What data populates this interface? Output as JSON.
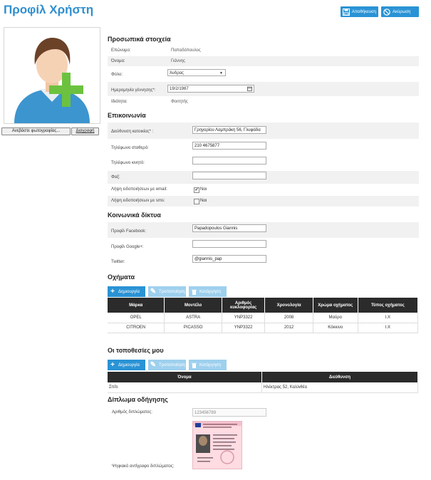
{
  "page": {
    "title": "Προφίλ Χρήστη"
  },
  "header_buttons": {
    "save": "Αποθήκευση",
    "cancel": "Ακύρωση"
  },
  "photo": {
    "file_button": "Ανεβάστε φωτογραφίας...",
    "delete_button": "Διαγραφή"
  },
  "personal": {
    "heading": "Προσωπικά στοιχεία",
    "surname_label": "Επώνυμο:",
    "surname_value": "Παπαδόπουλος",
    "name_label": "Όνομα:",
    "name_value": "Γιάννης",
    "gender_label": "Φύλο:",
    "gender_value": "Άνδρας",
    "birth_label": "Ημερομηνία γέννησης*:",
    "birth_value": "19/2/1987",
    "role_label": "Ιδιότητα:",
    "role_value": "Φοιτητής"
  },
  "contact": {
    "heading": "Επικοινωνία",
    "address_label": "Διεύθυνση κατοικίας* :",
    "address_value": "Γρηγορίου Λαμπράκη 56, Γλυφάδα",
    "phone_label": "Τηλέφωνο σταθερό:",
    "phone_value": "210 4675877",
    "mobile_label": "Τηλέφωνο κινητό:",
    "mobile_value": "",
    "fax_label": "Φαξ:",
    "fax_value": "",
    "email_notif_label": "Λήψη ειδοποιήσεων με email:",
    "email_notif_check": "✔",
    "email_notif_text": "Ναι",
    "sms_notif_label": "Λήψη ειδοποιήσεων με sms:",
    "sms_notif_text": "Ναι"
  },
  "social": {
    "heading": "Κοινωνικά δίκτυα",
    "facebook_label": "Προφίλ Facebook:",
    "facebook_value": "Papadopoulos Giannis",
    "google_label": "Προφίλ Google+:",
    "google_value": "",
    "twitter_label": "Twitter:",
    "twitter_value": "@giannis_pap"
  },
  "vehicles": {
    "heading": "Οχήματα",
    "create": "Δημιουργία",
    "edit": "Τροποποίηση",
    "delete": "Κατάργηση",
    "columns": [
      "Μάρκα",
      "Μοντέλο",
      "Αριθμός κυκλοφορίας",
      "Χρονολογία",
      "Χρώμα οχήματος",
      "Τύπος οχήματος"
    ],
    "rows": [
      [
        "OPEL",
        "ASTRA",
        "YNP3322",
        "2008",
        "Μαύρο",
        "I.X"
      ],
      [
        "CITROEN",
        "PICASSO",
        "YNP3322",
        "2012",
        "Κόκκινο",
        "I.X"
      ]
    ]
  },
  "locations": {
    "heading": "Οι τοποθεσίες μου",
    "create": "Δημιουργία",
    "edit": "Τροποποίηση",
    "delete": "Κατάργηση",
    "columns": [
      "Όνομα",
      "Διεύθυνση"
    ],
    "rows": [
      [
        "Σπίτι",
        "Ηλέκτρας 52, Καλλιθέα"
      ]
    ]
  },
  "license": {
    "heading": "Δίπλωμα οδήγησης",
    "number_label": "Αριθμός διπλώματος:",
    "number_value": "123456789",
    "copy_label": "Ψηφιακό αντίγραφο διπλώματος:"
  },
  "colors": {
    "accent": "#2a93d5",
    "accent_light": "#9ed0ee",
    "title": "#2f8fcf",
    "table_header": "#2b2b2b"
  }
}
